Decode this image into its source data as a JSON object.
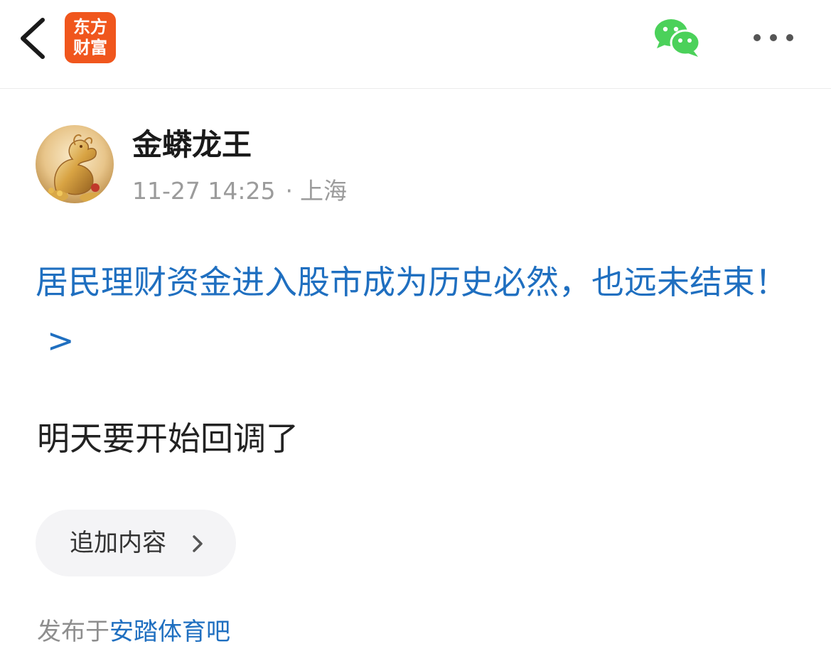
{
  "header": {
    "logo_line1": "东方",
    "logo_line2": "财富",
    "back_icon": "chevron-left-icon",
    "share_icon": "wechat-icon",
    "more_icon": "more-horizontal-icon",
    "brand_color": "#f0561d",
    "wechat_color": "#4bd15a"
  },
  "post": {
    "author": "金蟒龙王",
    "time": "11-27 14:25",
    "separator": "·",
    "location": "上海",
    "link_title": "居民理财资金进入股市成为历史必然，也远未结束！",
    "link_chevron": ">",
    "body": "明天要开始回调了",
    "append_label": "追加内容",
    "posted_prefix": "发布于",
    "bar_name": "安踏体育吧",
    "link_color": "#1f6fc0"
  }
}
